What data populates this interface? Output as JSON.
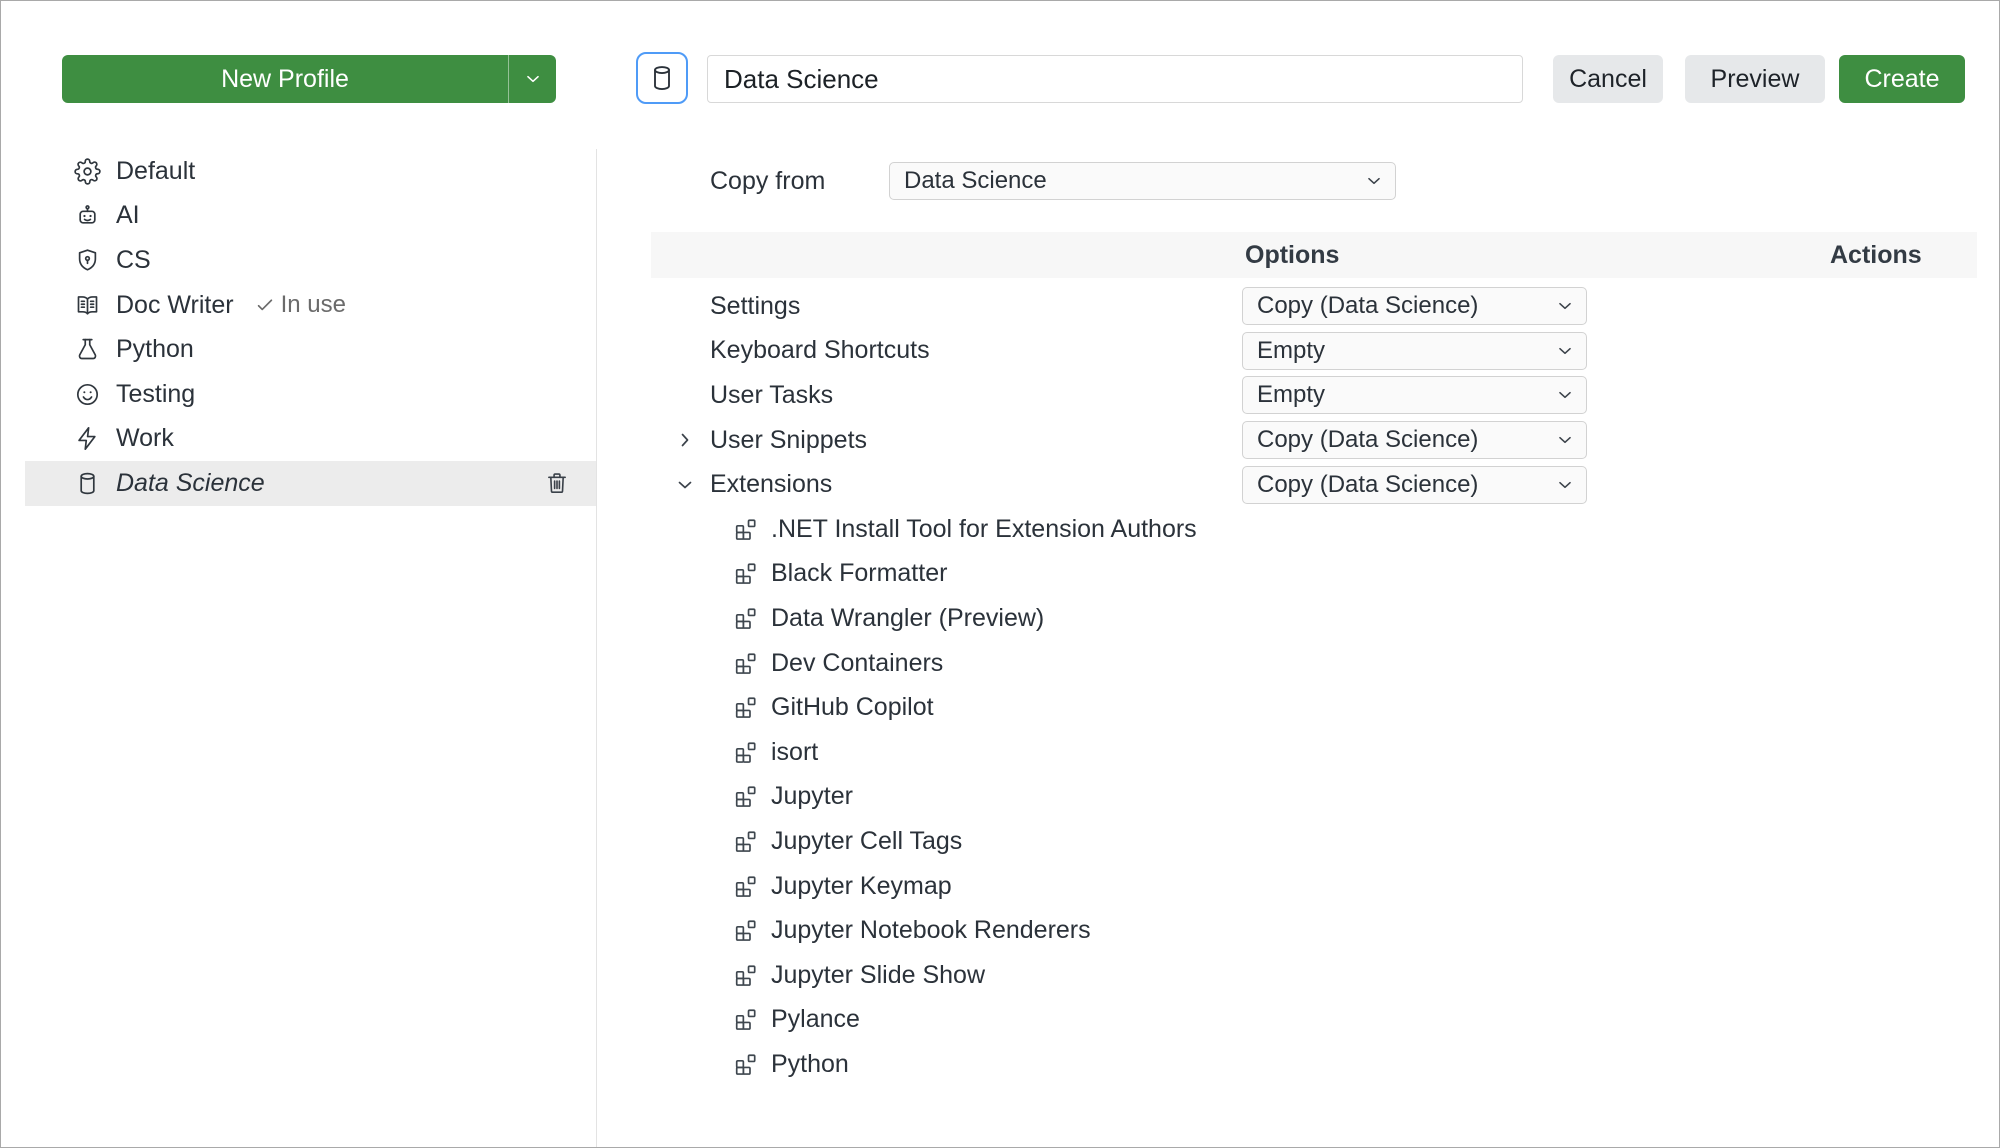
{
  "sidebar": {
    "new_profile": "New Profile",
    "profiles": [
      {
        "name": "Default"
      },
      {
        "name": "AI"
      },
      {
        "name": "CS"
      },
      {
        "name": "Doc Writer",
        "badge": "In use"
      },
      {
        "name": "Python"
      },
      {
        "name": "Testing"
      },
      {
        "name": "Work"
      },
      {
        "name": "Data Science"
      }
    ]
  },
  "header": {
    "profile_name": "Data Science",
    "cancel": "Cancel",
    "preview": "Preview",
    "create": "Create"
  },
  "copy_from": {
    "label": "Copy from",
    "selected": "Data Science"
  },
  "table": {
    "columns": {
      "options": "Options",
      "actions": "Actions"
    },
    "rows": [
      {
        "label": "Settings",
        "option": "Copy (Data Science)"
      },
      {
        "label": "Keyboard Shortcuts",
        "option": "Empty"
      },
      {
        "label": "User Tasks",
        "option": "Empty"
      },
      {
        "label": "User Snippets",
        "option": "Copy (Data Science)"
      },
      {
        "label": "Extensions",
        "option": "Copy (Data Science)"
      }
    ],
    "extensions": [
      ".NET Install Tool for Extension Authors",
      "Black Formatter",
      "Data Wrangler (Preview)",
      "Dev Containers",
      "GitHub Copilot",
      "isort",
      "Jupyter",
      "Jupyter Cell Tags",
      "Jupyter Keymap",
      "Jupyter Notebook Renderers",
      "Jupyter Slide Show",
      "Pylance",
      "Python"
    ]
  },
  "colors": {
    "accent_green": "#3E8E41",
    "focus_blue": "#4F9BF7",
    "selected_row": "#ECECEC",
    "header_strip": "#F7F7F7"
  }
}
